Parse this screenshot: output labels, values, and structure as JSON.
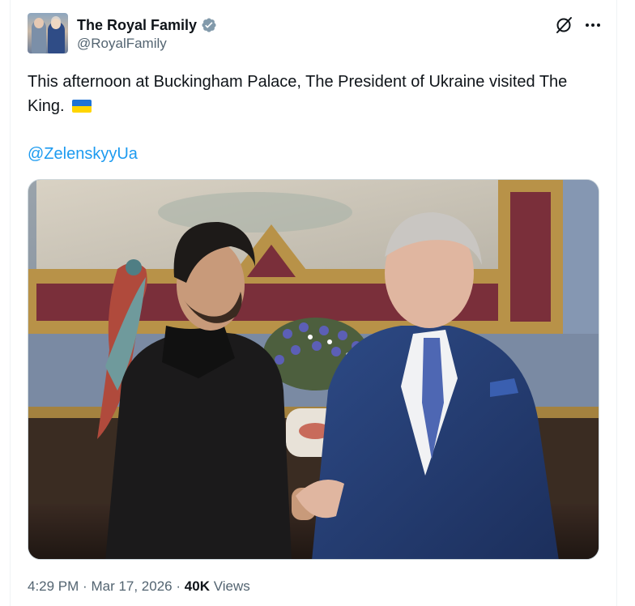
{
  "account": {
    "display_name": "The Royal Family",
    "handle": "@RoyalFamily",
    "verified_icon": "verified-badge-gray"
  },
  "tweet": {
    "text": "This afternoon at Buckingham Palace, The President of Ukraine visited The King.",
    "emoji": "ukraine-flag",
    "mention": "@ZelenskyyUa"
  },
  "meta": {
    "time": "4:29 PM",
    "separator": "·",
    "date": "Mar 17, 2026",
    "views_count": "40K",
    "views_label": "Views"
  },
  "icons": {
    "grok": "grok-icon",
    "more": "more-icon"
  },
  "colors": {
    "link": "#1d9bf0",
    "muted": "#536471",
    "flag_blue": "#1e73d6",
    "flag_yellow": "#ffd500"
  }
}
